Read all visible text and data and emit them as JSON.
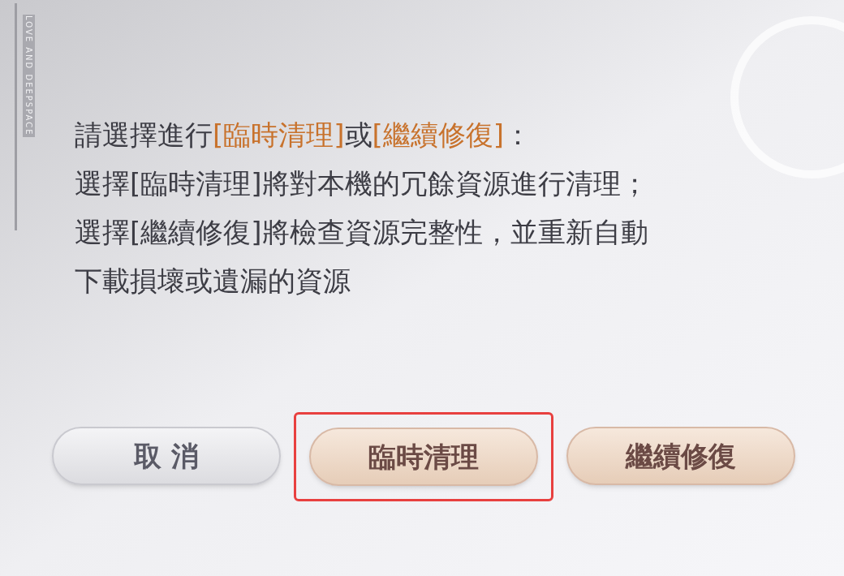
{
  "brand_text": "LOVE AND DEEPSPACE",
  "message": {
    "lines": [
      [
        {
          "text": "請選擇進行",
          "highlight": false
        },
        {
          "text": "[臨時清理]",
          "highlight": true
        },
        {
          "text": "或",
          "highlight": false
        },
        {
          "text": "[繼續修復]",
          "highlight": true
        },
        {
          "text": "：",
          "highlight": false
        }
      ],
      [
        {
          "text": "選擇[臨時清理]將對本機的冗餘資源進行清理；",
          "highlight": false
        }
      ],
      [
        {
          "text": "選擇[繼續修復]將檢查資源完整性，並重新自動",
          "highlight": false
        }
      ],
      [
        {
          "text": "下載損壞或遺漏的資源",
          "highlight": false
        }
      ]
    ]
  },
  "buttons": [
    {
      "label": "取 消",
      "kind": "secondary",
      "annotated": false
    },
    {
      "label": "臨時清理",
      "kind": "primary",
      "annotated": true
    },
    {
      "label": "繼續修復",
      "kind": "primary",
      "annotated": false
    }
  ]
}
